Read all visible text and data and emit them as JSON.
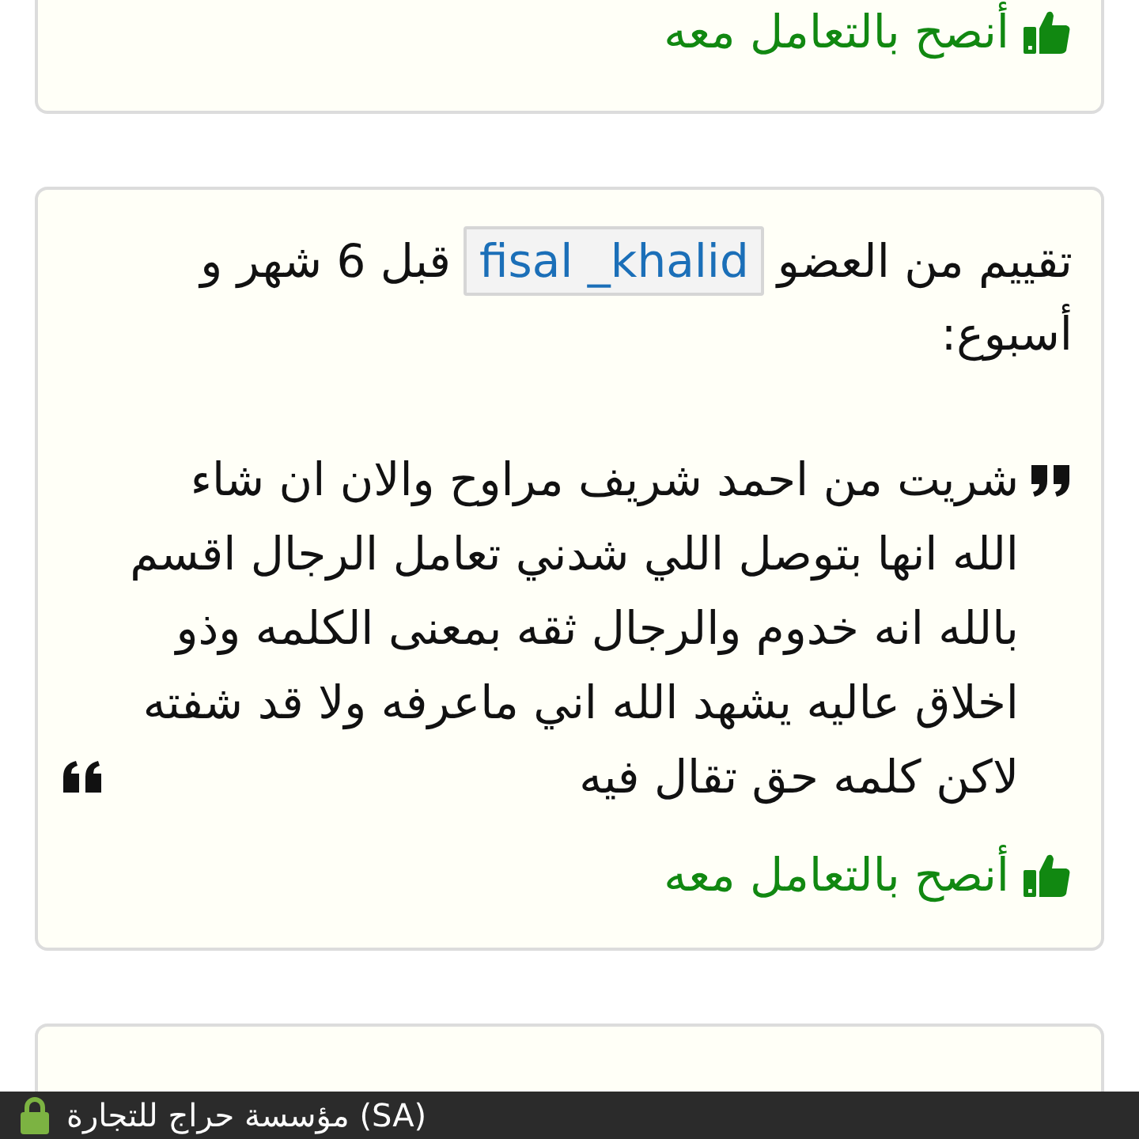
{
  "reviews": [
    {
      "kind": "tail",
      "recommendation": "أنصح بالتعامل معه"
    },
    {
      "kind": "full",
      "prefix": "تقييم من العضو",
      "user": "fisal _khalid",
      "time": "قبل 6 شهر و أسبوع:",
      "quote": "شريت من احمد شريف مراوح والان ان شاء الله انها بتوصل اللي شدني تعامل الرجال اقسم بالله انه خدوم والرجال ثقه بمعنى الكلمه وذو اخلاق عاليه يشهد الله اني ماعرفه ولا قد شفته لاكن كلمه حق تقال فيه",
      "recommendation": "أنصح بالتعامل معه"
    },
    {
      "kind": "head"
    }
  ],
  "status_bar": {
    "text": "مؤسسة حراج للتجارة (SA)",
    "secure": true
  }
}
